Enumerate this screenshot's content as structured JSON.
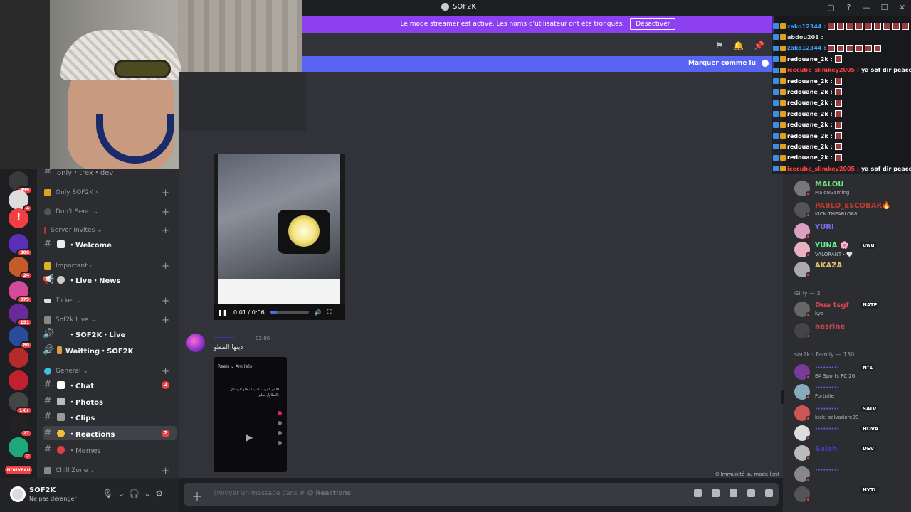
{
  "window": {
    "title": "SOF2K",
    "controls": [
      "▢",
      "?",
      "—",
      "☐",
      "✕"
    ]
  },
  "streamer_banner": {
    "text": "Le mode streamer est activé. Les noms d'utilisateur ont été tronqués.",
    "button": "Désactiver"
  },
  "new_messages_bar": {
    "label": "Marquer comme lu"
  },
  "servers": [
    {
      "badge": "499",
      "color": "#3a3a3a"
    },
    {
      "badge": "4",
      "color": "#dcdcdc"
    },
    {
      "badge": "",
      "color": "#f23f43",
      "glyph": "!"
    },
    {
      "badge": "306",
      "color": "#5b2fb8"
    },
    {
      "badge": "24",
      "color": "#c55a2a"
    },
    {
      "badge": "379",
      "color": "#d44a9a"
    },
    {
      "badge": "191",
      "color": "#6a2a9a"
    },
    {
      "badge": "80",
      "color": "#2a4a9a"
    },
    {
      "badge": "",
      "color": "#b52a2a"
    },
    {
      "badge": "",
      "color": "#c21f2f"
    },
    {
      "badge": "1K+",
      "color": "#444"
    },
    {
      "badge": "27",
      "color": "#222"
    },
    {
      "badge": "2",
      "color": "#1fa77a"
    },
    {
      "badge": "NOUVEAU",
      "color": "#f23f43"
    }
  ],
  "channels": {
    "top_partial": "only・trex・dev",
    "categories": [
      {
        "name": "Only SOF2K",
        "chev": "›"
      },
      {
        "name": "Don't Send",
        "chev": "⌄"
      },
      {
        "name": "Server Invites",
        "chev": "⌄"
      },
      {
        "name": "Important",
        "chev": "›"
      },
      {
        "name": "Ticket",
        "chev": "⌄"
      },
      {
        "name": "Sof2k Live",
        "chev": "⌄"
      },
      {
        "name": "General",
        "chev": "⌄"
      },
      {
        "name": "Chill Zone",
        "chev": "⌄"
      }
    ],
    "items": [
      {
        "name": "・Welcome"
      },
      {
        "name": "・Live・News"
      },
      {
        "name": "・SOF2K・Live"
      },
      {
        "name": "Waitting・SOF2K"
      },
      {
        "name": "・Chat",
        "badge": "2"
      },
      {
        "name": "・Photos"
      },
      {
        "name": "・Clips"
      },
      {
        "name": "・Reactions",
        "badge": "2"
      },
      {
        "name": "・Memes"
      }
    ]
  },
  "user_panel": {
    "name": "SOF2K",
    "status": "Ne pas déranger"
  },
  "video": {
    "time": "0:01 / 0:06",
    "progress": 0.17
  },
  "message": {
    "author": "·········",
    "time": "02:06",
    "text": "ديتها المطو",
    "phone_top": "Reels ⌄   Ami(e)s",
    "phone_text": "للاخو العرب السيما بطلو الرسائل بالتطاول بحلو"
  },
  "slowmode": "Immunité au mode lent",
  "composer": {
    "placeholder_prefix": "Envoyer un message dans #",
    "channel": "Reactions"
  },
  "members": {
    "top": [
      {
        "name": "MALOU",
        "status": "MalouGaming",
        "color": "#6ee07a",
        "av": "#777"
      },
      {
        "name": "PABLO_ESCOBAR🔥",
        "status": "KICK:THPABLO88",
        "color": "#c5392a",
        "av": "#555"
      },
      {
        "name": "YURI",
        "status": "",
        "color": "#7b6cf0",
        "av": "#d9a0c0"
      },
      {
        "name": "YUNA 🌸",
        "status": "VALORANT・🤍",
        "color": "#5ff08a",
        "av": "#e8b0c0",
        "tag": "uwu"
      },
      {
        "name": "AKAZA",
        "status": "",
        "color": "#e0c26a",
        "av": "#aaa"
      }
    ],
    "girly_header": "Girly — 2",
    "girly": [
      {
        "name": "Dua tsgf",
        "status": "kys",
        "color": "#d8454f",
        "av": "#666",
        "tag": "NATE"
      },
      {
        "name": "nesrine",
        "status": "",
        "color": "#d8454f",
        "av": "#444"
      }
    ],
    "family_header": "sor2k・Family — 130",
    "family": [
      {
        "name": "·········",
        "status": "EA Sports FC 26",
        "color": "#6d5cf0",
        "av": "#7a3a9a",
        "tag": "N°1"
      },
      {
        "name": "·········",
        "status": "Fortnite",
        "color": "#6d5cf0",
        "av": "#8ab"
      },
      {
        "name": "·········",
        "status": "kick: salvadore99",
        "color": "#6d5cf0",
        "av": "#c55",
        "tag": "SALV"
      },
      {
        "name": "·········",
        "status": "",
        "color": "#6d5cf0",
        "av": "#ddd",
        "tag": "HOVA"
      },
      {
        "name": "Salah",
        "status": "",
        "color": "#4a3fd0",
        "av": "#bbb",
        "tag": "DEV"
      },
      {
        "name": "·········",
        "status": "",
        "color": "#6d5cf0",
        "av": "#888"
      },
      {
        "name": "",
        "status": "",
        "color": "#fff",
        "av": "#555",
        "tag": "HYTL"
      }
    ]
  },
  "twitch_chat": [
    {
      "user": "zako12344 :",
      "color": "#40a0ff",
      "msg": "",
      "emotes": 10
    },
    {
      "user": "abdou201 :",
      "color": "#dcdcdc",
      "msg": "",
      "emotes": 0
    },
    {
      "user": "zako12344 :",
      "color": "#40a0ff",
      "msg": "",
      "emotes": 6
    },
    {
      "user": "redouane_2k :",
      "color": "#ffffff",
      "msg": "",
      "emotes": 1
    },
    {
      "user": "icecube_slimkey2005 :",
      "color": "#ff4040",
      "msg": "ya sof dir peace 🩸 ndrblk p",
      "emotes": 0
    },
    {
      "user": "redouane_2k :",
      "color": "#ffffff",
      "msg": "",
      "emotes": 1
    },
    {
      "user": "redouane_2k :",
      "color": "#ffffff",
      "msg": "",
      "emotes": 1
    },
    {
      "user": "redouane_2k :",
      "color": "#ffffff",
      "msg": "",
      "emotes": 1
    },
    {
      "user": "redouane_2k :",
      "color": "#ffffff",
      "msg": "",
      "emotes": 1
    },
    {
      "user": "redouane_2k :",
      "color": "#ffffff",
      "msg": "",
      "emotes": 1
    },
    {
      "user": "redouane_2k :",
      "color": "#ffffff",
      "msg": "",
      "emotes": 1
    },
    {
      "user": "redouane_2k :",
      "color": "#ffffff",
      "msg": "",
      "emotes": 1
    },
    {
      "user": "redouane_2k :",
      "color": "#ffffff",
      "msg": "",
      "emotes": 1
    },
    {
      "user": "icecube_slimkey2005 :",
      "color": "#ff4040",
      "msg": "ya sof dir peace 🩸 ndrblk p",
      "emotes": 0
    }
  ]
}
